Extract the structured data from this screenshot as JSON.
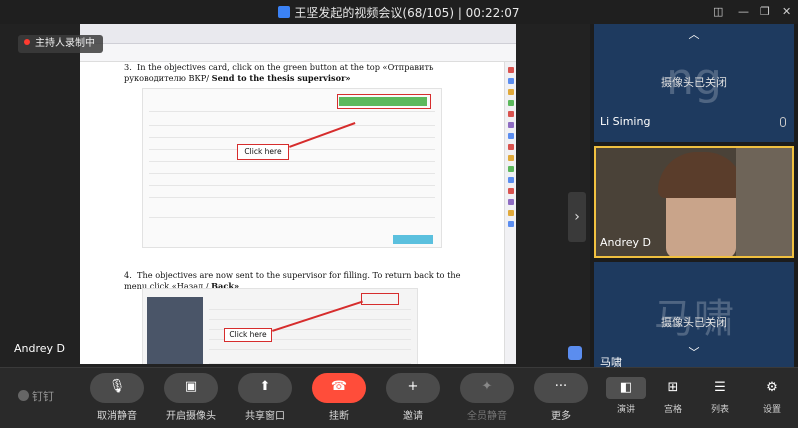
{
  "window": {
    "title": "王坚发起的视频会议(68/105)  |  00:22:07",
    "controls": [
      "◫",
      "—",
      "❐",
      "✕"
    ]
  },
  "recording": {
    "label": "主持人录制中"
  },
  "shared_document": {
    "step3": {
      "number": "3.",
      "text": "In the objectives card, click on the green button at the top «Отправить руководителю ВКР/ ",
      "bold": "Send to the thesis supervisor»"
    },
    "step4": {
      "number": "4.",
      "text": "The objectives are now sent to the supervisor for filling. To return back to the menu click «Назад / ",
      "bold": "Back»"
    },
    "callout1": "Click here",
    "callout2": "Click here"
  },
  "stage": {
    "active_speaker": "Andrey D",
    "next_arrow": "›"
  },
  "participants": [
    {
      "initials": "ng",
      "camera_status": "摄像头已关闭",
      "name": "Li Siming",
      "muted": true
    },
    {
      "name": "Andrey D",
      "video": true
    },
    {
      "initials": "马啸",
      "camera_status": "摄像头已关闭",
      "name": "马啸"
    }
  ],
  "toolbar": {
    "brand": "钉钉",
    "buttons": [
      {
        "label": "取消静音",
        "glyph": "🎙"
      },
      {
        "label": "开启摄像头",
        "glyph": "▣"
      },
      {
        "label": "共享窗口",
        "glyph": "⬆"
      },
      {
        "label": "挂断",
        "glyph": "☎"
      },
      {
        "label": "邀请",
        "glyph": "+"
      },
      {
        "label": "全员静音",
        "glyph": "✦"
      },
      {
        "label": "更多",
        "glyph": "···"
      }
    ],
    "layouts": [
      {
        "label": "演讲",
        "glyph": "◧"
      },
      {
        "label": "宫格",
        "glyph": "⊞"
      },
      {
        "label": "列表",
        "glyph": "☰"
      },
      {
        "label": "设置",
        "glyph": "⚙"
      }
    ]
  }
}
